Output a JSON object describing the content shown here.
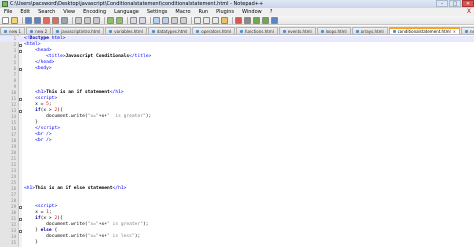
{
  "window": {
    "title": "C:\\Users\\pacsword\\Desktop\\javascript\\Conditionalstatement\\conditionalstatement.html - Notepad++",
    "buttons": [
      "–",
      "□",
      "✕"
    ]
  },
  "menu": {
    "items": [
      "File",
      "Edit",
      "Search",
      "View",
      "Encoding",
      "Language",
      "Settings",
      "Macro",
      "Run",
      "Plugins",
      "Window",
      "?"
    ],
    "close_doc": "X"
  },
  "toolbar": {
    "icons": [
      "new-file-icon",
      "open-file-icon",
      "save-icon",
      "save-all-icon",
      "close-icon",
      "close-all-icon",
      "print-icon",
      "cut-icon",
      "copy-icon",
      "paste-icon",
      "undo-icon",
      "redo-icon",
      "find-icon",
      "replace-icon",
      "zoom-in-icon",
      "zoom-out-icon",
      "sync-v-icon",
      "sync-h-icon",
      "wrap-icon",
      "all-chars-icon",
      "indent-guide-icon",
      "lang-icon",
      "macro-record-icon",
      "macro-stop-icon",
      "macro-play-icon",
      "macro-run-icon",
      "macro-save-icon"
    ]
  },
  "tabs": [
    {
      "label": "new 1",
      "active": false
    },
    {
      "label": "new 2",
      "active": false
    },
    {
      "label": "javascriptintro.html",
      "active": false
    },
    {
      "label": "variables.html",
      "active": false
    },
    {
      "label": "datatypes.html",
      "active": false
    },
    {
      "label": "operators.html",
      "active": false
    },
    {
      "label": "functions.html",
      "active": false
    },
    {
      "label": "events.html",
      "active": false
    },
    {
      "label": "loops.html",
      "active": false
    },
    {
      "label": "arrays.html",
      "active": false
    },
    {
      "label": "conditionalstatement.html",
      "active": true
    },
    {
      "label": "new 3",
      "active": false
    }
  ],
  "editor": {
    "current_line": 1,
    "lines": [
      {
        "n": "1",
        "html": "<span class=\"tag\">&lt;!</span><span class=\"kw\">Doctype</span> <span class=\"tag\">html&gt;</span>",
        "fold": false
      },
      {
        "n": "2",
        "html": "<span class=\"tag\">&lt;html&gt;</span>",
        "fold": true
      },
      {
        "n": "3",
        "html": "    <span class=\"tag\">&lt;head&gt;</span>",
        "fold": true
      },
      {
        "n": "4",
        "html": "        <span class=\"tag\">&lt;title&gt;</span><span class=\"txt\">Javascript Conditionals</span><span class=\"tag\">&lt;/title&gt;</span>",
        "fold": false
      },
      {
        "n": "5",
        "html": "    <span class=\"tag\">&lt;/head&gt;</span>",
        "fold": false
      },
      {
        "n": "6",
        "html": "    <span class=\"tag\">&lt;body&gt;</span>",
        "fold": true
      },
      {
        "n": "7",
        "html": "",
        "fold": false
      },
      {
        "n": "8",
        "html": "",
        "fold": false
      },
      {
        "n": "9",
        "html": "",
        "fold": false
      },
      {
        "n": "10",
        "html": "    <span class=\"tag\">&lt;h1&gt;</span><span class=\"txt\">This is an if statement</span><span class=\"tag\">&lt;/h1&gt;</span>",
        "fold": false
      },
      {
        "n": "11",
        "html": "    <span class=\"tag\">&lt;script&gt;</span>",
        "fold": true
      },
      {
        "n": "12",
        "html": "    x = <span class=\"num\">5</span>;",
        "fold": false
      },
      {
        "n": "13",
        "html": "    <span class=\"kw\">if</span>(x &gt; <span class=\"num\">2</span>){",
        "fold": true
      },
      {
        "n": "14",
        "html": "        document.write(<span class=\"str\">\"x=\"</span>+x+<span class=\"str\">\"  is greater\"</span>);",
        "fold": false
      },
      {
        "n": "15",
        "html": "    }",
        "fold": false
      },
      {
        "n": "16",
        "html": "    <span class=\"tag\">&lt;/script&gt;</span>",
        "fold": false
      },
      {
        "n": "17",
        "html": "    <span class=\"tag\">&lt;br /&gt;</span>",
        "fold": false
      },
      {
        "n": "18",
        "html": "    <span class=\"tag\">&lt;br /&gt;</span>",
        "fold": false
      },
      {
        "n": "19",
        "html": "",
        "fold": false
      },
      {
        "n": "20",
        "html": "",
        "fold": false
      },
      {
        "n": "21",
        "html": "",
        "fold": false
      },
      {
        "n": "22",
        "html": "",
        "fold": false
      },
      {
        "n": "23",
        "html": "",
        "fold": false
      },
      {
        "n": "24",
        "html": "",
        "fold": false
      },
      {
        "n": "25",
        "html": "",
        "fold": false
      },
      {
        "n": "26",
        "html": "<span class=\"tag\">&lt;h1&gt;</span><span class=\"txt\">This is an if else statement</span><span class=\"tag\">&lt;/h1&gt;</span>",
        "fold": false
      },
      {
        "n": "27",
        "html": "",
        "fold": false
      },
      {
        "n": "28",
        "html": "",
        "fold": false
      },
      {
        "n": "29",
        "html": "    <span class=\"tag\">&lt;script&gt;</span>",
        "fold": true
      },
      {
        "n": "30",
        "html": "    x = <span class=\"num\">1</span>;",
        "fold": false
      },
      {
        "n": "31",
        "html": "    <span class=\"kw\">if</span>(x &gt; <span class=\"num\">2</span>){",
        "fold": true
      },
      {
        "n": "32",
        "html": "        document.write(<span class=\"str\">\"x=\"</span>+x+<span class=\"str\">\" is greater\"</span>);",
        "fold": false
      },
      {
        "n": "33",
        "html": "    } <span class=\"kw\">else</span> {",
        "fold": true
      },
      {
        "n": "34",
        "html": "        document.write(<span class=\"str\">\"x=\"</span>+x+<span class=\"str\">\" is less\"</span>);",
        "fold": false
      },
      {
        "n": "35",
        "html": "    }",
        "fold": false
      }
    ]
  }
}
